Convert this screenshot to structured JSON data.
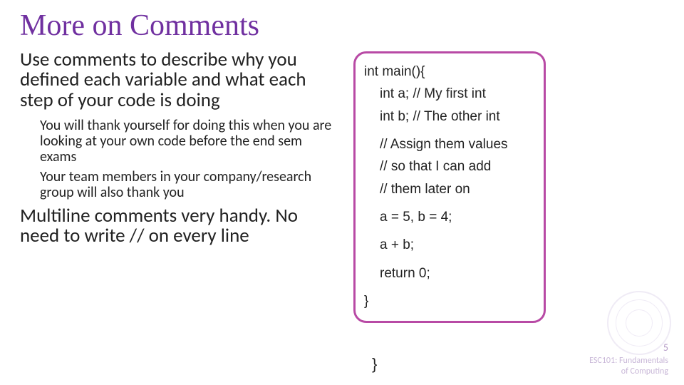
{
  "title": "More on Comments",
  "left": {
    "p1": "Use comments to describe why you defined each variable and what each step of your code is doing",
    "sub1": "You will thank yourself for doing this when you are looking at your own code before the end sem exams",
    "sub2": "Your team members in your company/research group will also thank you",
    "p2": "Multiline comments very handy. No need to write // on every line"
  },
  "code": {
    "l1": "int main(){",
    "l2": "int a; // My first int",
    "l3": "int b; // The other int",
    "l4": "// Assign them values",
    "l5": "// so that I can add",
    "l6": "// them later on",
    "l7": "a = 5, b = 4;",
    "l8": "a + b;",
    "l9": "return 0;",
    "l10": "}"
  },
  "stray_brace": "}",
  "footer": {
    "page": "5",
    "course1": "ESC101: Fundamentals",
    "course2": "of Computing"
  }
}
